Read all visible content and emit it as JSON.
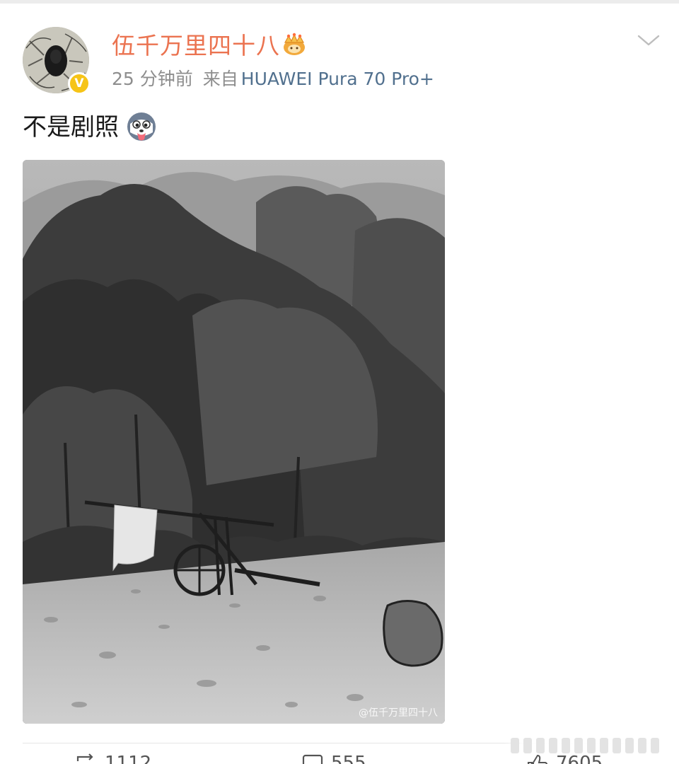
{
  "post": {
    "author": {
      "name": "伍千万里四十八",
      "verified_badge": "V",
      "avatar_icon": "avatar-image",
      "crown_icon": "crown-icon"
    },
    "time": "25 分钟前",
    "source_prefix": "来自",
    "source_device": "HUAWEI Pura 70 Pro+",
    "text": "不是剧照",
    "text_emoji": "husky-tongue-emoji",
    "image": {
      "watermark": "@伍千万里四十八"
    }
  },
  "actions": {
    "repost": {
      "icon": "repost-icon",
      "count": "1112"
    },
    "comment": {
      "icon": "comment-icon",
      "count": "555"
    },
    "like": {
      "icon": "like-icon",
      "count": "7605"
    }
  },
  "colors": {
    "username": "#eb7350",
    "device_link": "#51708e",
    "meta_gray": "#8e8e8e",
    "badge_yellow": "#f6c417"
  }
}
